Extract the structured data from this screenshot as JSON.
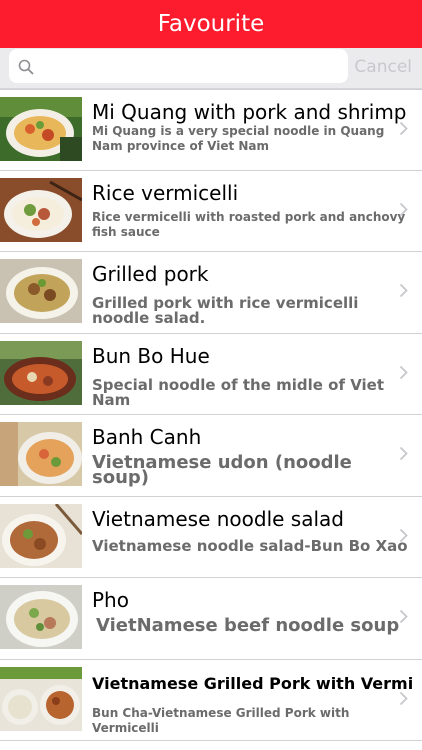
{
  "navbar": {
    "title": "Favourite"
  },
  "search": {
    "placeholder": "",
    "value": "",
    "cancel_label": "Cancel"
  },
  "colors": {
    "accent": "#fc1c2e",
    "chevron": "#c7c7cc",
    "subtitle": "#6b6b6b"
  },
  "favourites": [
    {
      "title": "Mi Quang with pork and shrimp",
      "subtitle": "Mi Quang is a very special noodle in Quang Nam province of Viet Nam"
    },
    {
      "title": "Rice vermicelli",
      "subtitle": "Rice vermicelli with roasted pork and anchovy fish sauce"
    },
    {
      "title": "Grilled pork",
      "subtitle": "Grilled pork with rice vermicelli noodle salad."
    },
    {
      "title": "Bun Bo Hue",
      "subtitle": "Special noodle of the midle of Viet Nam"
    },
    {
      "title": "Banh Canh",
      "subtitle": "Vietnamese udon (noodle soup)"
    },
    {
      "title": "Vietnamese noodle salad",
      "subtitle": "Vietnamese noodle salad-Bun Bo Xao"
    },
    {
      "title": "Pho",
      "subtitle": "VietNamese beef noodle soup"
    },
    {
      "title": "Vietnamese Grilled Pork with Vermicelli",
      "subtitle": "Bun Cha-Vietnamese Grilled Pork with Vermicelli"
    }
  ]
}
